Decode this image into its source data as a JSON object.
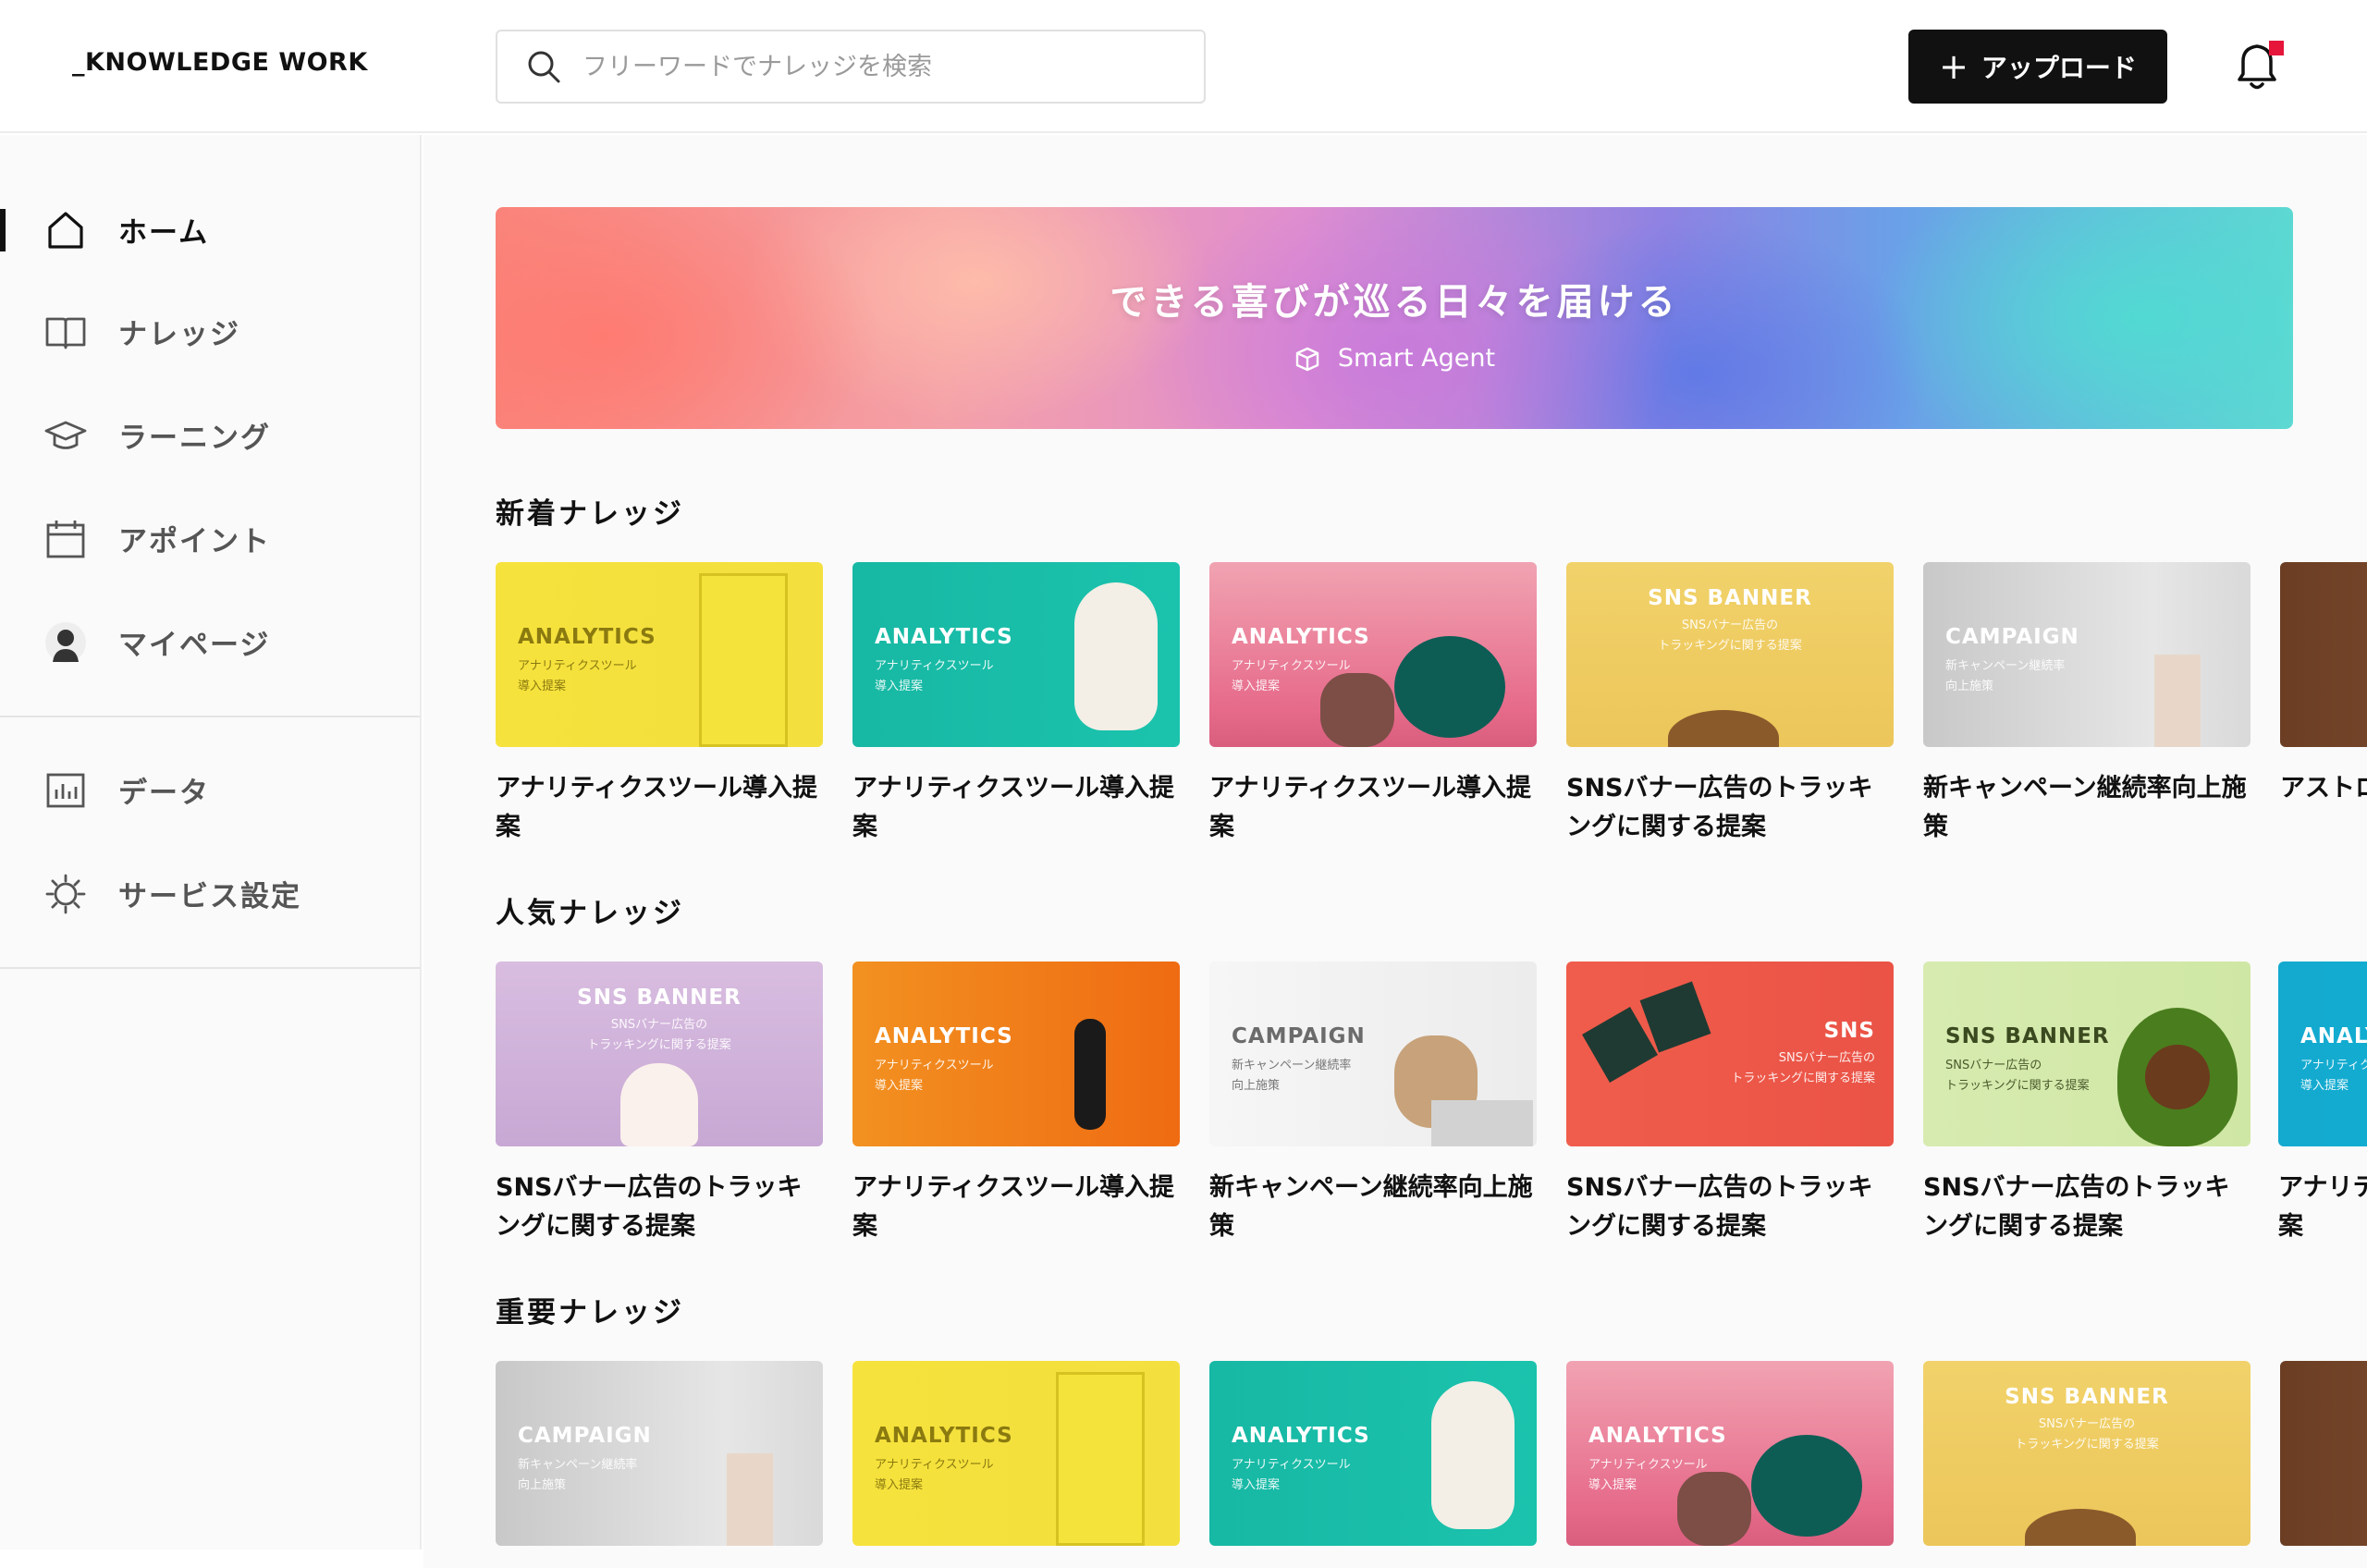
{
  "header": {
    "logo": "_KNOWLEDGE WORK",
    "search_placeholder": "フリーワードでナレッジを検索",
    "upload_label": "アップロード",
    "upload_plus": "+"
  },
  "colors": {
    "accent": "#111111",
    "notification": "#e5163a"
  },
  "sidebar": {
    "items": [
      {
        "label": "ホーム",
        "icon": "home-icon",
        "active": true
      },
      {
        "label": "ナレッジ",
        "icon": "book-icon"
      },
      {
        "label": "ラーニング",
        "icon": "graduation-cap-icon"
      },
      {
        "label": "アポイント",
        "icon": "calendar-icon"
      },
      {
        "label": "マイページ",
        "icon": "user-avatar-icon"
      },
      {
        "label": "データ",
        "icon": "bar-chart-icon"
      },
      {
        "label": "サービス設定",
        "icon": "gear-icon"
      }
    ]
  },
  "hero": {
    "title": "できる喜びが巡る日々を届ける",
    "subtitle": "Smart Agent"
  },
  "sections": [
    {
      "title": "新着ナレッジ",
      "cards": [
        {
          "tag": "ANALYTICS",
          "tag_sub": "アナリティクスツール\n導入提案",
          "title": "アナリティクスツール導入提案"
        },
        {
          "tag": "ANALYTICS",
          "tag_sub": "アナリティクスツール\n導入提案",
          "title": "アナリティクスツール導入提案"
        },
        {
          "tag": "ANALYTICS",
          "tag_sub": "アナリティクスツール\n導入提案",
          "title": "アナリティクスツール導入提案"
        },
        {
          "tag": "SNS BANNER",
          "tag_sub": "SNSバナー広告の\nトラッキングに関する提案",
          "title": "SNSバナー広告のトラッキングに関する提案"
        },
        {
          "tag": "CAMPAIGN",
          "tag_sub": "新キャンペーン継続率\n向上施策",
          "title": "新キャンペーン継続率向上施策"
        },
        {
          "tag": "",
          "tag_sub": "",
          "title": "アストロ"
        }
      ]
    },
    {
      "title": "人気ナレッジ",
      "cards": [
        {
          "tag": "SNS BANNER",
          "tag_sub": "SNSバナー広告の\nトラッキングに関する提案",
          "title": "SNSバナー広告のトラッキングに関する提案"
        },
        {
          "tag": "ANALYTICS",
          "tag_sub": "アナリティクスツール\n導入提案",
          "title": "アナリティクスツール導入提案"
        },
        {
          "tag": "CAMPAIGN",
          "tag_sub": "新キャンペーン継続率\n向上施策",
          "title": "新キャンペーン継続率向上施策"
        },
        {
          "tag": "SNS",
          "tag_sub": "SNSバナー広告の\nトラッキングに関する提案",
          "title": "SNSバナー広告のトラッキングに関する提案"
        },
        {
          "tag": "SNS BANNER",
          "tag_sub": "SNSバナー広告の\nトラッキングに関する提案",
          "title": "SNSバナー広告のトラッキングに関する提案"
        },
        {
          "tag": "ANALYTICS",
          "tag_sub": "アナリティクスツール\n導入提案",
          "title": "アナリティクスツール導入提案"
        }
      ]
    },
    {
      "title": "重要ナレッジ",
      "cards": [
        {
          "tag": "CAMPAIGN",
          "tag_sub": "新キャンペーン継続率\n向上施策",
          "title": ""
        },
        {
          "tag": "ANALYTICS",
          "tag_sub": "アナリティクスツール\n導入提案",
          "title": ""
        },
        {
          "tag": "ANALYTICS",
          "tag_sub": "アナリティクスツール\n導入提案",
          "title": ""
        },
        {
          "tag": "ANALYTICS",
          "tag_sub": "アナリティクスツール\n導入提案",
          "title": ""
        },
        {
          "tag": "SNS BANNER",
          "tag_sub": "SNSバナー広告の\nトラッキングに関する提案",
          "title": ""
        },
        {
          "tag": "",
          "tag_sub": "",
          "title": ""
        }
      ]
    }
  ]
}
